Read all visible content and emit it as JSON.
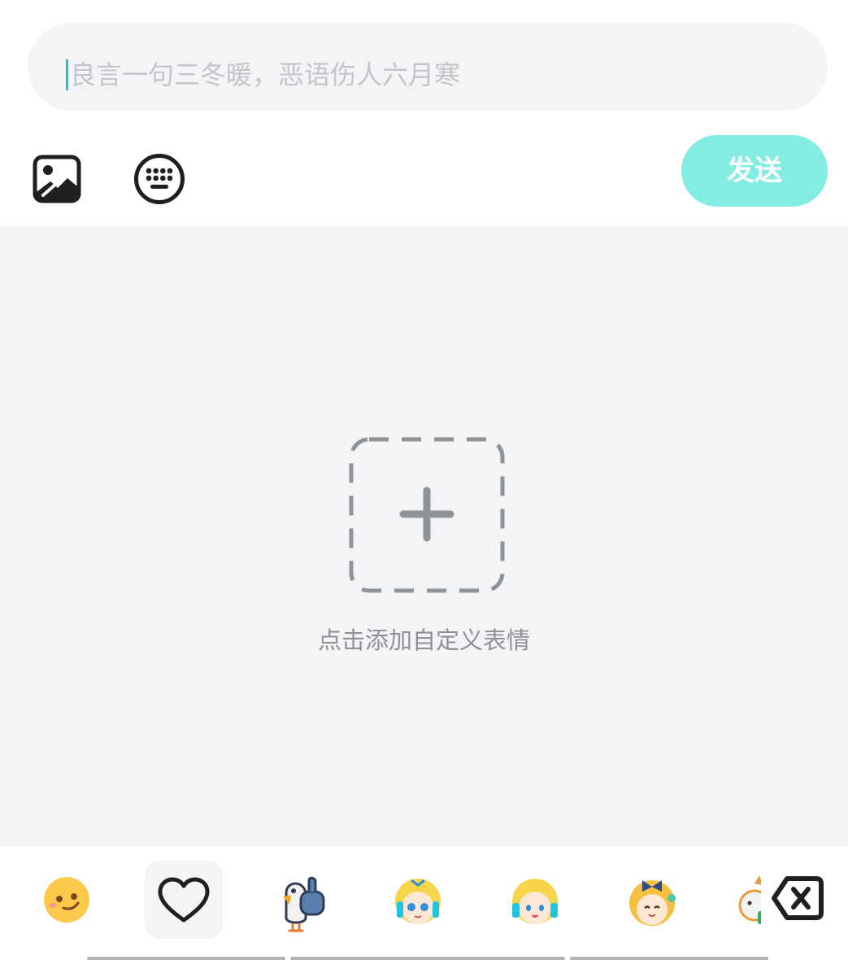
{
  "composer": {
    "placeholder": "良言一句三冬暖，恶语伤人六月寒",
    "send_label": "发送"
  },
  "toolbar": {
    "icons": [
      "image-icon",
      "keyboard-icon"
    ]
  },
  "custom_panel": {
    "add_label": "点击添加自定义表情"
  },
  "emoji_tabs": [
    {
      "name": "smiley-face-icon"
    },
    {
      "name": "heart-icon",
      "active": true
    },
    {
      "name": "bird-thumbs-up-sticker"
    },
    {
      "name": "anime-girl-sticker-1"
    },
    {
      "name": "anime-girl-sticker-2"
    },
    {
      "name": "anime-girl-bow-sticker"
    },
    {
      "name": "shiba-sticker"
    }
  ],
  "colors": {
    "accent": "#19c9c0",
    "send_button": "#84ede3",
    "panel_bg": "#f3f4f6",
    "placeholder_text": "#c3c5c9",
    "hint_text": "#8e9094"
  }
}
